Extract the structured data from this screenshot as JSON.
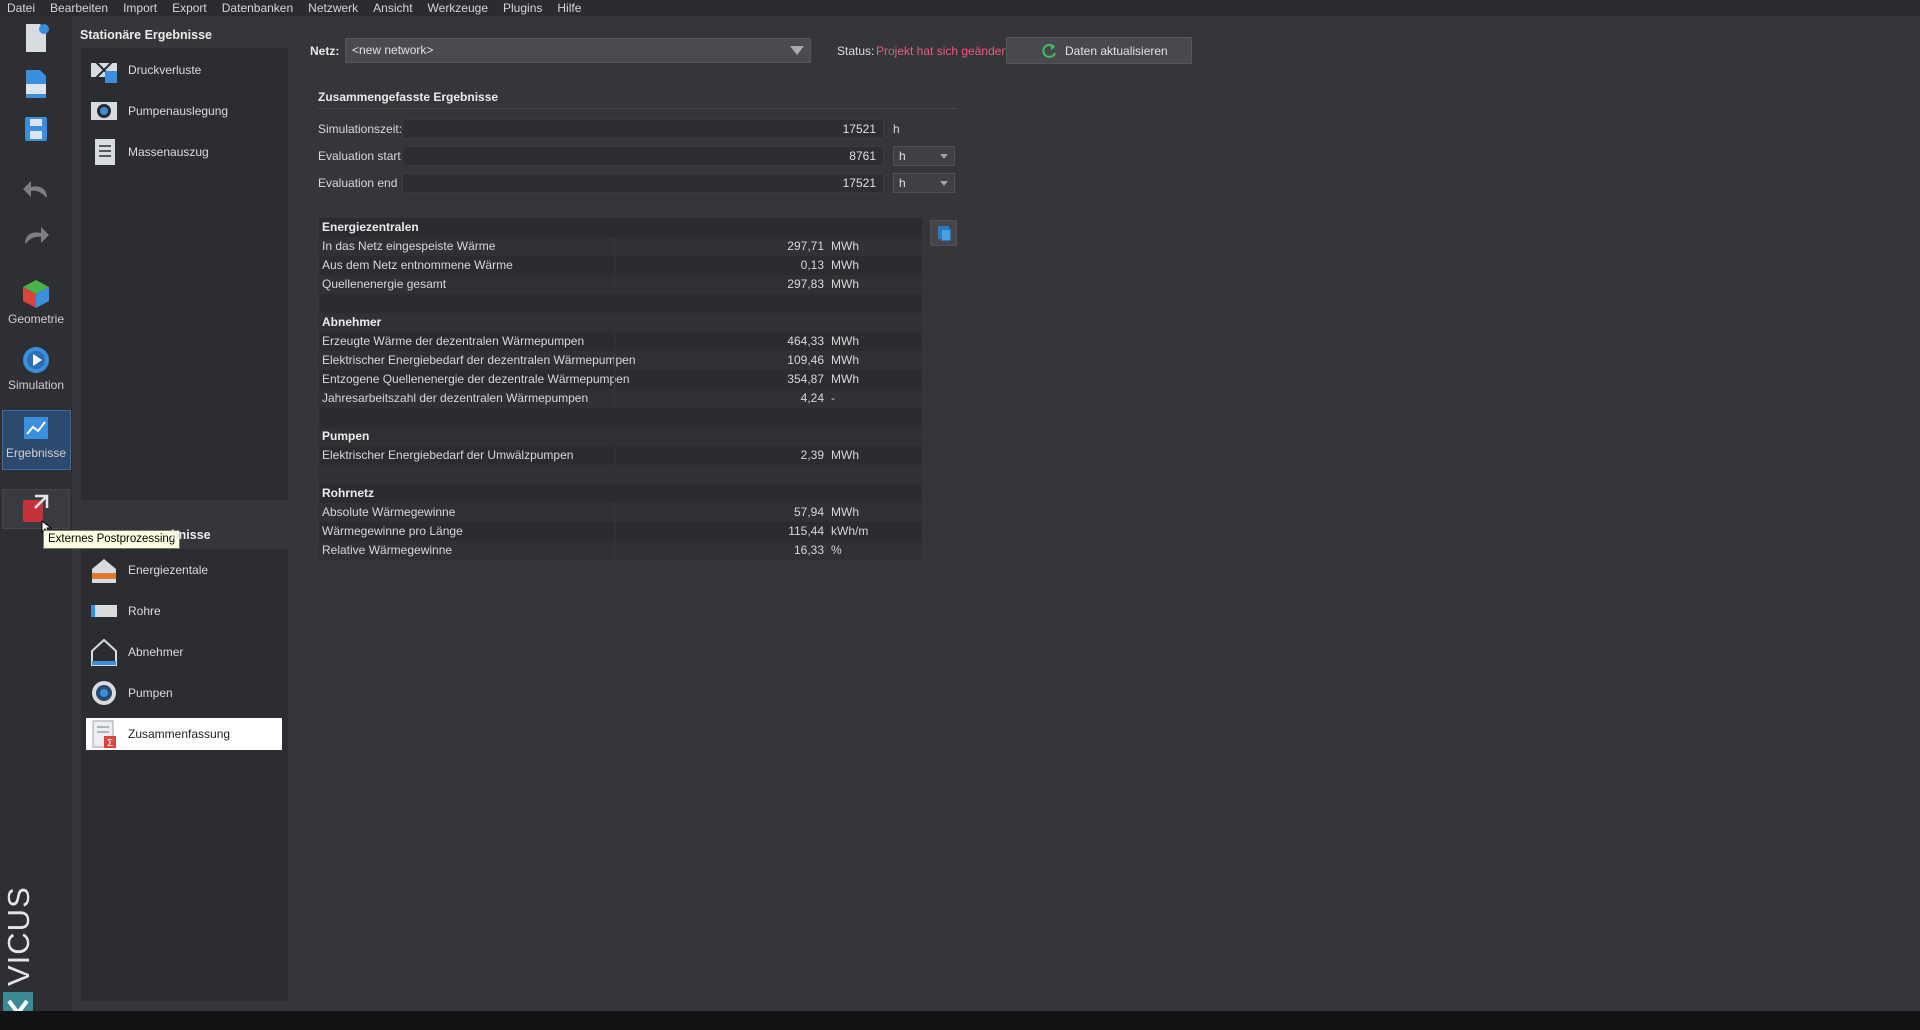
{
  "menu": [
    "Datei",
    "Bearbeiten",
    "Import",
    "Export",
    "Datenbanken",
    "Netzwerk",
    "Ansicht",
    "Werkzeuge",
    "Plugins",
    "Hilfe"
  ],
  "toolbar": {
    "geometry_label": "Geometrie",
    "simulation_label": "Simulation",
    "results_label": "Ergebnisse",
    "brand": "VICUS"
  },
  "tooltip": "Externes Postprozessing",
  "stationary": {
    "title": "Stationäre Ergebnisse",
    "items": [
      "Druckverluste",
      "Pumpenauslegung",
      "Massenauszug"
    ]
  },
  "dynamic": {
    "title_visible": "bnisse",
    "items": [
      "Energiezentale",
      "Rohre",
      "Abnehmer",
      "Pumpen",
      "Zusammenfassung"
    ]
  },
  "netz": {
    "label": "Netz:",
    "value": "<new network>"
  },
  "status": {
    "label": "Status:",
    "value": "Projekt hat sich geändert"
  },
  "refresh_label": "Daten aktualisieren",
  "summary": {
    "title": "Zusammengefasste Ergebnisse",
    "sim_time": {
      "label": "Simulationszeit:",
      "value": "17521",
      "unit": "h"
    },
    "eval_start": {
      "label": "Evaluation start",
      "value": "8761",
      "unit": "h"
    },
    "eval_end": {
      "label": "Evaluation end",
      "value": "17521",
      "unit": "h"
    }
  },
  "results": {
    "s1": {
      "header": "Energiezentralen",
      "rows": [
        {
          "label": "In das Netz eingespeiste Wärme",
          "value": "297,71",
          "unit": "MWh"
        },
        {
          "label": "Aus dem Netz entnommene Wärme",
          "value": "0,13",
          "unit": "MWh"
        },
        {
          "label": "Quellenenergie gesamt",
          "value": "297,83",
          "unit": "MWh"
        }
      ]
    },
    "s2": {
      "header": "Abnehmer",
      "rows": [
        {
          "label": "Erzeugte Wärme der dezentralen Wärmepumpen",
          "value": "464,33",
          "unit": "MWh"
        },
        {
          "label": "Elektrischer Energiebedarf der dezentralen Wärmepumpen",
          "value": "109,46",
          "unit": "MWh"
        },
        {
          "label": "Entzogene Quellenenergie der dezentrale Wärmepumpen",
          "value": "354,87",
          "unit": "MWh"
        },
        {
          "label": "Jahresarbeitszahl der dezentralen Wärmepumpen",
          "value": "4,24",
          "unit": "-"
        }
      ]
    },
    "s3": {
      "header": "Pumpen",
      "rows": [
        {
          "label": "Elektrischer Energiebedarf der Umwälzpumpen",
          "value": "2,39",
          "unit": "MWh"
        }
      ]
    },
    "s4": {
      "header": "Rohrnetz",
      "rows": [
        {
          "label": "Absolute Wärmegewinne",
          "value": "57,94",
          "unit": "MWh"
        },
        {
          "label": "Wärmegewinne pro Länge",
          "value": "115,44",
          "unit": "kWh/m"
        },
        {
          "label": "Relative Wärmegewinne",
          "value": "16,33",
          "unit": "%"
        }
      ]
    }
  },
  "colors": {
    "status_changed": "#ea5b7c",
    "accent_blue": "#2b79c2",
    "selected_bg": "#ffffff"
  }
}
